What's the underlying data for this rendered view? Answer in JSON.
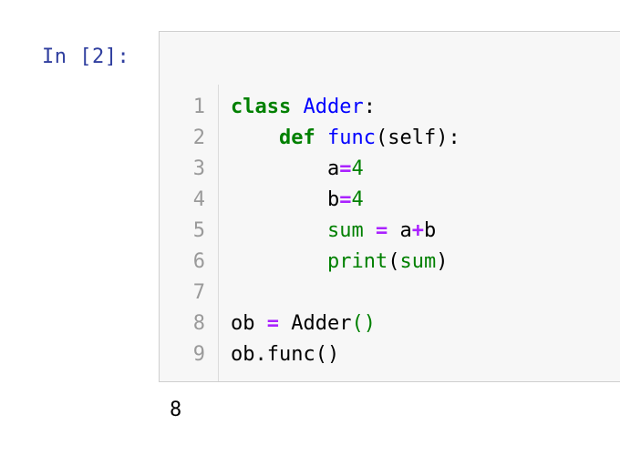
{
  "cell": {
    "prompt": "In [2]:",
    "lines": [
      {
        "n": "1",
        "parts": [
          {
            "t": "class",
            "c": "kw"
          },
          {
            "t": " ",
            "c": ""
          },
          {
            "t": "Adder",
            "c": "def"
          },
          {
            "t": ":",
            "c": ""
          }
        ]
      },
      {
        "n": "2",
        "parts": [
          {
            "t": "    ",
            "c": ""
          },
          {
            "t": "def",
            "c": "kw"
          },
          {
            "t": " ",
            "c": ""
          },
          {
            "t": "func",
            "c": "def"
          },
          {
            "t": "(self):",
            "c": ""
          }
        ]
      },
      {
        "n": "3",
        "parts": [
          {
            "t": "        a",
            "c": ""
          },
          {
            "t": "=",
            "c": "op"
          },
          {
            "t": "4",
            "c": "num"
          }
        ]
      },
      {
        "n": "4",
        "parts": [
          {
            "t": "        b",
            "c": ""
          },
          {
            "t": "=",
            "c": "op"
          },
          {
            "t": "4",
            "c": "num"
          }
        ]
      },
      {
        "n": "5",
        "parts": [
          {
            "t": "        ",
            "c": ""
          },
          {
            "t": "sum",
            "c": "builtin"
          },
          {
            "t": " ",
            "c": ""
          },
          {
            "t": "=",
            "c": "op"
          },
          {
            "t": " a",
            "c": ""
          },
          {
            "t": "+",
            "c": "op"
          },
          {
            "t": "b",
            "c": ""
          }
        ]
      },
      {
        "n": "6",
        "parts": [
          {
            "t": "        ",
            "c": ""
          },
          {
            "t": "print",
            "c": "builtin"
          },
          {
            "t": "(",
            "c": ""
          },
          {
            "t": "sum",
            "c": "builtin"
          },
          {
            "t": ")",
            "c": ""
          }
        ]
      },
      {
        "n": "7",
        "parts": []
      },
      {
        "n": "8",
        "parts": [
          {
            "t": "ob ",
            "c": ""
          },
          {
            "t": "=",
            "c": "op"
          },
          {
            "t": " Adder",
            "c": ""
          },
          {
            "t": "()",
            "c": "paren-g"
          }
        ]
      },
      {
        "n": "9",
        "parts": [
          {
            "t": "ob.func()",
            "c": ""
          }
        ]
      }
    ]
  },
  "output": {
    "text": "8"
  },
  "colors": {
    "prompt": "#303f9f",
    "keyword": "#008000",
    "definition": "#0000ff",
    "operator": "#aa22ff",
    "cell_background": "#f7f7f7",
    "cell_border": "#cfcfcf"
  }
}
